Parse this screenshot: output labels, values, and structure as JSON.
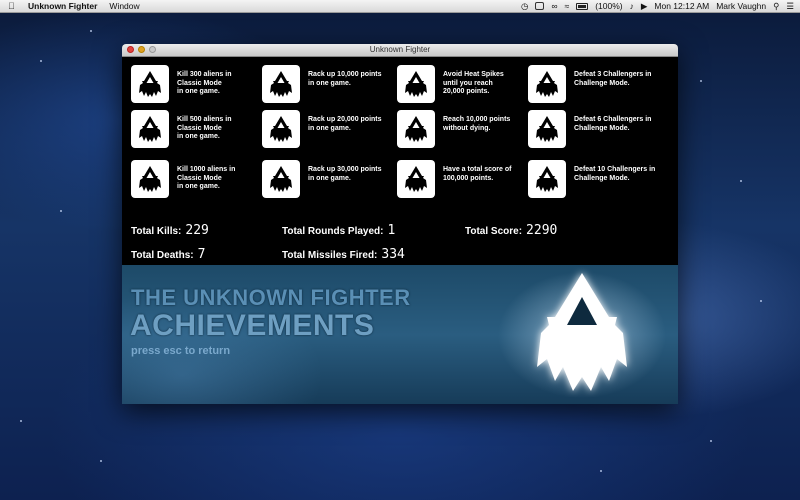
{
  "menubar": {
    "app_name": "Unknown Fighter",
    "menus": [
      "Window"
    ],
    "battery_text": "(100%)",
    "clock": "Mon 12:12 AM",
    "user": "Mark Vaughn"
  },
  "window": {
    "title": "Unknown Fighter"
  },
  "achievements": [
    {
      "text": "Kill 300 aliens in Classic Mode in one game.",
      "lines": [
        "Kill 300 aliens in",
        "Classic Mode",
        "in one game."
      ]
    },
    {
      "text": "Rack up 10,000 points in one game.",
      "lines": [
        "Rack up 10,000 points",
        "in one game."
      ]
    },
    {
      "text": "Avoid Heat Spikes until you reach 20,000 points.",
      "lines": [
        "Avoid Heat Spikes",
        "until you reach",
        "20,000 points."
      ]
    },
    {
      "text": "Defeat 3 Challengers in Challenge Mode.",
      "lines": [
        "Defeat 3 Challengers in",
        "Challenge Mode."
      ]
    },
    {
      "text": "Kill 500 aliens in Classic Mode in one game.",
      "lines": [
        "Kill 500 aliens in",
        "Classic Mode",
        "in one game."
      ]
    },
    {
      "text": "Rack up 20,000 points in one game.",
      "lines": [
        "Rack up 20,000 points",
        "in one game."
      ]
    },
    {
      "text": "Reach 10,000 points without dying.",
      "lines": [
        "Reach 10,000 points",
        "without dying."
      ]
    },
    {
      "text": "Defeat 6 Challengers in Challenge Mode.",
      "lines": [
        "Defeat 6 Challengers in",
        "Challenge Mode."
      ]
    },
    {
      "text": "Kill 1000 aliens in Classic Mode in one game.",
      "lines": [
        "Kill 1000 aliens in",
        "Classic Mode",
        "in one game."
      ]
    },
    {
      "text": "Rack up 30,000 points in one game.",
      "lines": [
        "Rack up 30,000 points",
        "in one game."
      ]
    },
    {
      "text": "Have a total score of 100,000 points.",
      "lines": [
        "Have a total score of",
        "100,000 points."
      ]
    },
    {
      "text": "Defeat 10 Challengers in Challenge Mode.",
      "lines": [
        "Defeat 10 Challengers in",
        "Challenge Mode."
      ]
    }
  ],
  "stats": {
    "total_kills_label": "Total Kills:",
    "total_kills": "229",
    "total_rounds_label": "Total Rounds Played:",
    "total_rounds": "1",
    "total_score_label": "Total Score:",
    "total_score": "2290",
    "total_deaths_label": "Total Deaths:",
    "total_deaths": "7",
    "total_missiles_label": "Total Missiles Fired:",
    "total_missiles": "334"
  },
  "banner": {
    "line1": "THE UNKNOWN FIGHTER",
    "line2": "ACHIEVEMENTS",
    "hint": "press esc to return"
  },
  "colors": {
    "achievement_icon_bg": "#ffffff",
    "banner_text": "#6e9fc2",
    "window_bg": "#000000"
  }
}
